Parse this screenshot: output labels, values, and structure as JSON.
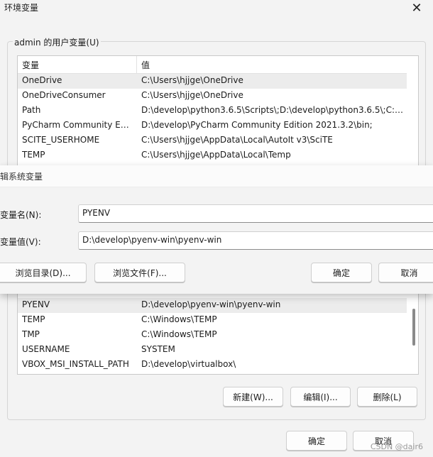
{
  "window": {
    "title": "环境变量"
  },
  "user_vars": {
    "group_label": "admin 的用户变量(U)",
    "header": {
      "name": "变量",
      "value": "值"
    },
    "rows": [
      {
        "name": "OneDrive",
        "value": "C:\\Users\\hjjge\\OneDrive"
      },
      {
        "name": "OneDriveConsumer",
        "value": "C:\\Users\\hjjge\\OneDrive"
      },
      {
        "name": "Path",
        "value": "D:\\develop\\python3.6.5\\Scripts\\;D:\\develop\\python3.6.5\\;C:\\U..."
      },
      {
        "name": "PyCharm Community Editi...",
        "value": "D:\\develop\\PyCharm Community Edition 2021.3.2\\bin;"
      },
      {
        "name": "SCITE_USERHOME",
        "value": "C:\\Users\\hjjge\\AppData\\Local\\AutoIt v3\\SciTE"
      },
      {
        "name": "TEMP",
        "value": "C:\\Users\\hjjge\\AppData\\Local\\Temp"
      }
    ]
  },
  "edit_dialog": {
    "title": "辑系统变量",
    "name_label": "变量名(N):",
    "name_value": "PYENV",
    "value_label": "变量值(V):",
    "value_value": "D:\\develop\\pyenv-win\\pyenv-win",
    "browse_dir": "浏览目录(D)...",
    "browse_file": "浏览文件(F)...",
    "ok": "确定",
    "cancel": "取消"
  },
  "system_vars": {
    "rows": [
      {
        "name": "PYENV",
        "value": "D:\\develop\\pyenv-win\\pyenv-win",
        "selected": true
      },
      {
        "name": "TEMP",
        "value": "C:\\Windows\\TEMP"
      },
      {
        "name": "TMP",
        "value": "C:\\Windows\\TEMP"
      },
      {
        "name": "USERNAME",
        "value": "SYSTEM"
      },
      {
        "name": "VBOX_MSI_INSTALL_PATH",
        "value": "D:\\develop\\virtualbox\\"
      }
    ],
    "new_button": "新建(W)...",
    "edit_button": "编辑(I)...",
    "delete_button": "删除(L)"
  },
  "footer": {
    "ok": "确定",
    "cancel": "取消"
  },
  "watermark": "CSDN @dair6"
}
